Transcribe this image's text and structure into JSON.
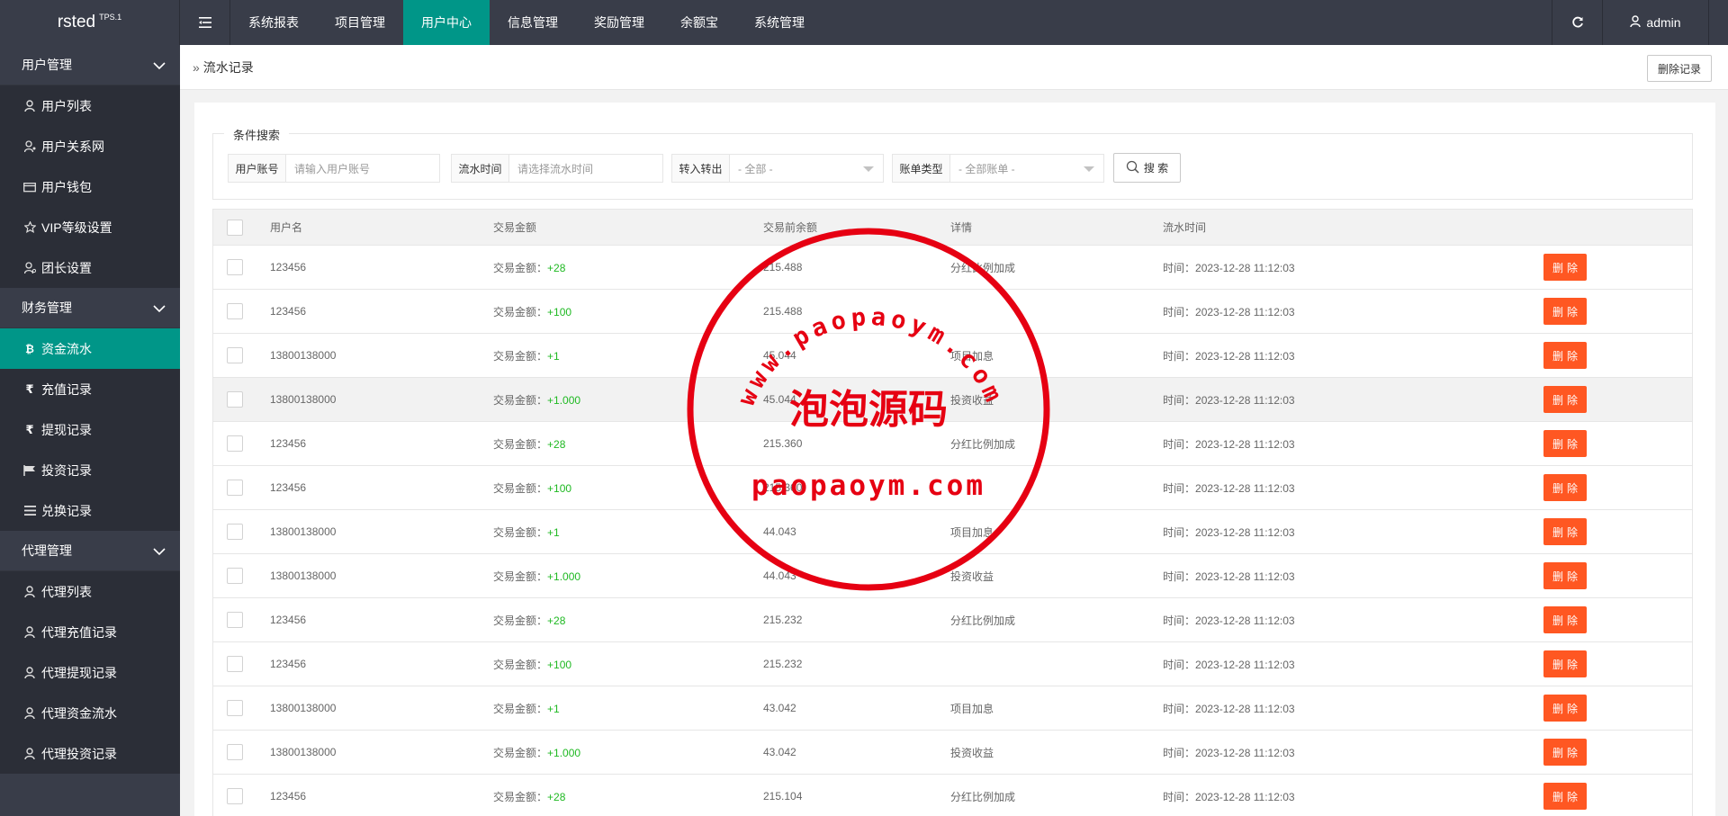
{
  "app": {
    "logo": "rsted",
    "logo_sup": "TPS.1",
    "menu_toggle_icon": "menu-toggle-icon",
    "nav": [
      {
        "label": "系统报表"
      },
      {
        "label": "项目管理"
      },
      {
        "label": "用户中心",
        "active": true
      },
      {
        "label": "信息管理"
      },
      {
        "label": "奖励管理"
      },
      {
        "label": "余额宝"
      },
      {
        "label": "系统管理"
      }
    ],
    "user": "admin",
    "accent": "#009688"
  },
  "sidebar": {
    "groups": [
      {
        "label": "用户管理",
        "items": [
          {
            "label": "用户列表",
            "icon": "user-icon"
          },
          {
            "label": "用户关系网",
            "icon": "user-network-icon"
          },
          {
            "label": "用户钱包",
            "icon": "wallet-icon"
          },
          {
            "label": "VIP等级设置",
            "icon": "star-icon"
          },
          {
            "label": "团长设置",
            "icon": "user-settings-icon"
          }
        ]
      },
      {
        "label": "财务管理",
        "items": [
          {
            "label": "资金流水",
            "icon": "bitcoin-icon",
            "active": true
          },
          {
            "label": "充值记录",
            "icon": "rupee-icon"
          },
          {
            "label": "提现记录",
            "icon": "rupee-icon"
          },
          {
            "label": "投资记录",
            "icon": "flag-icon"
          },
          {
            "label": "兑换记录",
            "icon": "list-icon"
          }
        ]
      },
      {
        "label": "代理管理",
        "items": [
          {
            "label": "代理列表",
            "icon": "user-icon"
          },
          {
            "label": "代理充值记录",
            "icon": "user-icon"
          },
          {
            "label": "代理提现记录",
            "icon": "user-icon"
          },
          {
            "label": "代理资金流水",
            "icon": "user-icon"
          },
          {
            "label": "代理投资记录",
            "icon": "user-icon"
          }
        ]
      }
    ]
  },
  "breadcrumb": {
    "current": "流水记录"
  },
  "actions": {
    "delete_records": "删除记录"
  },
  "search": {
    "legend": "条件搜索",
    "account_label": "用户账号",
    "account_placeholder": "请输入用户账号",
    "time_label": "流水时间",
    "time_placeholder": "请选择流水时间",
    "transfer_label": "转入转出",
    "transfer_value": "- 全部 -",
    "type_label": "账单类型",
    "type_value": "- 全部账单 -",
    "button": "搜 索"
  },
  "table": {
    "headers": [
      "用户名",
      "交易金额",
      "交易前余额",
      "详情",
      "流水时间"
    ],
    "amount_prefix": "交易金额：",
    "time_prefix": "时间：",
    "delete_label": "删除",
    "rows": [
      {
        "user": "123456",
        "amount": "+28",
        "balance": "215.488",
        "detail": "分红比例加成",
        "time": "2023-12-28 11:12:03"
      },
      {
        "user": "123456",
        "amount": "+100",
        "balance": "215.488",
        "detail": "",
        "time": "2023-12-28 11:12:03"
      },
      {
        "user": "13800138000",
        "amount": "+1",
        "balance": "45.044",
        "detail": "项目加息",
        "time": "2023-12-28 11:12:03"
      },
      {
        "user": "13800138000",
        "amount": "+1.000",
        "balance": "45.044",
        "detail": "投资收益",
        "time": "2023-12-28 11:12:03",
        "highlight": true
      },
      {
        "user": "123456",
        "amount": "+28",
        "balance": "215.360",
        "detail": "分红比例加成",
        "time": "2023-12-28 11:12:03"
      },
      {
        "user": "123456",
        "amount": "+100",
        "balance": "215.360",
        "detail": "",
        "time": "2023-12-28 11:12:03"
      },
      {
        "user": "13800138000",
        "amount": "+1",
        "balance": "44.043",
        "detail": "项目加息",
        "time": "2023-12-28 11:12:03"
      },
      {
        "user": "13800138000",
        "amount": "+1.000",
        "balance": "44.043",
        "detail": "投资收益",
        "time": "2023-12-28 11:12:03"
      },
      {
        "user": "123456",
        "amount": "+28",
        "balance": "215.232",
        "detail": "分红比例加成",
        "time": "2023-12-28 11:12:03"
      },
      {
        "user": "123456",
        "amount": "+100",
        "balance": "215.232",
        "detail": "",
        "time": "2023-12-28 11:12:03"
      },
      {
        "user": "13800138000",
        "amount": "+1",
        "balance": "43.042",
        "detail": "项目加息",
        "time": "2023-12-28 11:12:03"
      },
      {
        "user": "13800138000",
        "amount": "+1.000",
        "balance": "43.042",
        "detail": "投资收益",
        "time": "2023-12-28 11:12:03"
      },
      {
        "user": "123456",
        "amount": "+28",
        "balance": "215.104",
        "detail": "分红比例加成",
        "time": "2023-12-28 11:12:03"
      }
    ]
  },
  "watermark": {
    "arc_text": "www.paopaoym.com",
    "center_text": "泡泡源码",
    "bottom_text": "paopaoym.com",
    "color": "#e60012"
  }
}
